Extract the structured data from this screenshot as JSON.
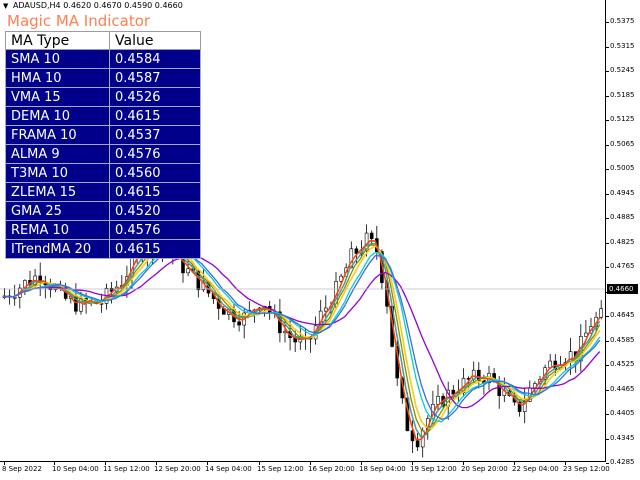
{
  "symbol_header": {
    "symbol": "ADAUSD,H4",
    "ohlc": "0.4620 0.4670 0.4590 0.4660"
  },
  "indicator_title": "Magic MA Indicator",
  "table": {
    "headers": [
      "MA Type",
      "Value"
    ],
    "rows": [
      {
        "type": "SMA 10",
        "value": "0.4584"
      },
      {
        "type": "HMA 10",
        "value": "0.4587"
      },
      {
        "type": "VMA 15",
        "value": "0.4526"
      },
      {
        "type": "DEMA 10",
        "value": "0.4615"
      },
      {
        "type": "FRAMA 10",
        "value": "0.4537"
      },
      {
        "type": "ALMA 9",
        "value": "0.4576"
      },
      {
        "type": "T3MA 10",
        "value": "0.4560"
      },
      {
        "type": "ZLEMA 15",
        "value": "0.4615"
      },
      {
        "type": "GMA 25",
        "value": "0.4520"
      },
      {
        "type": "REMA 10",
        "value": "0.4576"
      },
      {
        "type": "ITrendMA 20",
        "value": "0.4615"
      }
    ]
  },
  "price_axis": {
    "labels": [
      "0.5375",
      "0.5315",
      "0.5245",
      "0.5185",
      "0.5125",
      "0.5065",
      "0.5005",
      "0.4945",
      "0.4885",
      "0.4825",
      "0.4765",
      "0.4705",
      "0.4645",
      "0.4585",
      "0.4525",
      "0.4465",
      "0.4405",
      "0.4345",
      "0.4285"
    ],
    "current_price": "0.4660"
  },
  "time_axis": {
    "labels": [
      "8 Sep 2022",
      "10 Sep 04:00",
      "11 Sep 12:00",
      "12 Sep 20:00",
      "14 Sep 04:00",
      "15 Sep 12:00",
      "16 Sep 20:00",
      "18 Sep 04:00",
      "19 Sep 12:00",
      "20 Sep 20:00",
      "22 Sep 04:00",
      "23 Sep 12:00"
    ]
  },
  "colors": {
    "bull_candle": "#ffffff",
    "bear_candle": "#000000",
    "table_bg": "#00008b",
    "title": "#ff7f50",
    "ma_lines": [
      "#ff0000",
      "#ff8c00",
      "#8b4513",
      "#c71585",
      "#8b8b00",
      "#20b2aa",
      "#ffd700",
      "#ff4500",
      "#9400d3",
      "#00ced1",
      "#4169e1"
    ]
  }
}
